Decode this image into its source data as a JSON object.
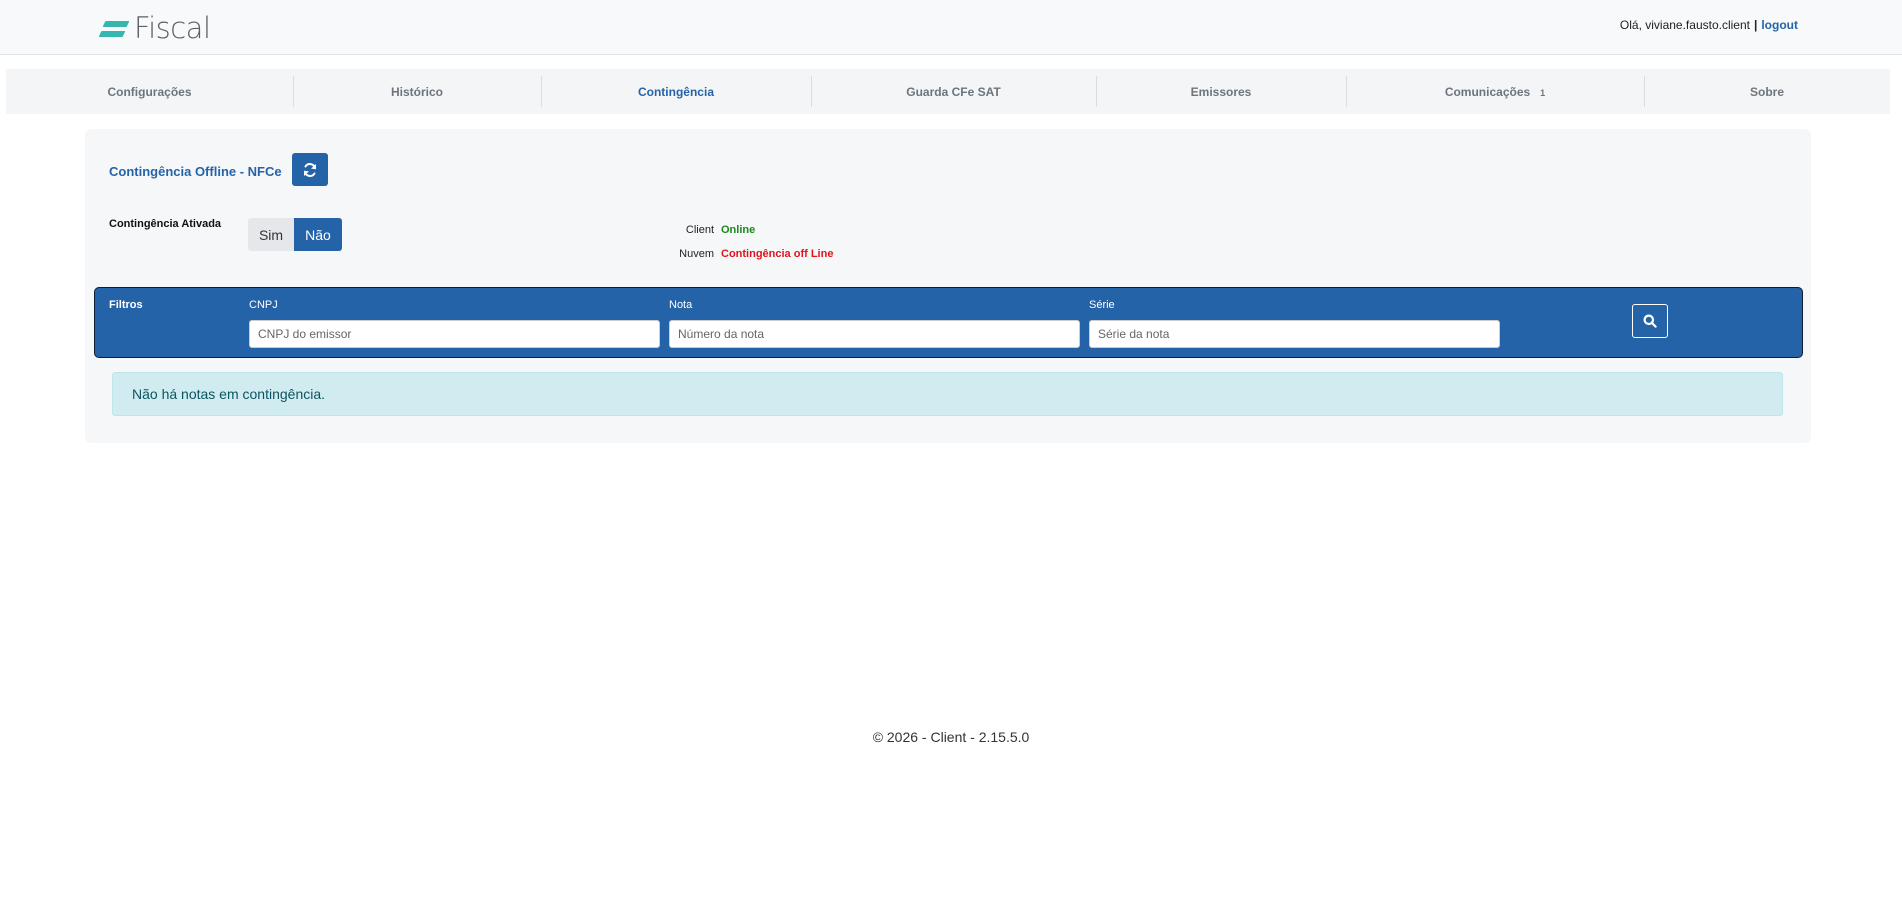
{
  "app": {
    "brand": "Fiscal",
    "brand_color": "#35b6ae",
    "accent": "#2563a8"
  },
  "user": {
    "greeting": "Olá, viviane.fausto.client",
    "separator": "|",
    "logout": "logout"
  },
  "nav": {
    "items": [
      {
        "label": "Configurações",
        "badge": ""
      },
      {
        "label": "Histórico",
        "badge": ""
      },
      {
        "label": "Contingência",
        "badge": ""
      },
      {
        "label": "Guarda CFe SAT",
        "badge": ""
      },
      {
        "label": "Emissores",
        "badge": ""
      },
      {
        "label": "Comunicações",
        "badge": "1"
      },
      {
        "label": "Sobre",
        "badge": ""
      }
    ],
    "active": "Contingência"
  },
  "page": {
    "title": "Contingência Offline - NFCe",
    "refresh_icon": "refresh-icon",
    "ativada_label": "Contingência Ativada",
    "toggle": {
      "sim": "Sim",
      "nao": "Não",
      "selected": "Não"
    },
    "status": {
      "client_label": "Client",
      "client_value": "Online",
      "nuvem_label": "Nuvem",
      "nuvem_value": "Contingência off Line",
      "online_color": "#1a8a1a",
      "offline_color": "#e0141e"
    }
  },
  "filters": {
    "label": "Filtros",
    "cnpj": {
      "label": "CNPJ",
      "placeholder": "CNPJ do emissor",
      "value": ""
    },
    "nota": {
      "label": "Nota",
      "placeholder": "Número da nota",
      "value": ""
    },
    "serie": {
      "label": "Série",
      "placeholder": "Série da nota",
      "value": ""
    },
    "search_icon": "search-icon"
  },
  "alert": {
    "message": "Não há notas em contingência."
  },
  "footer": {
    "text": "© 2026 - Client - 2.15.5.0"
  }
}
